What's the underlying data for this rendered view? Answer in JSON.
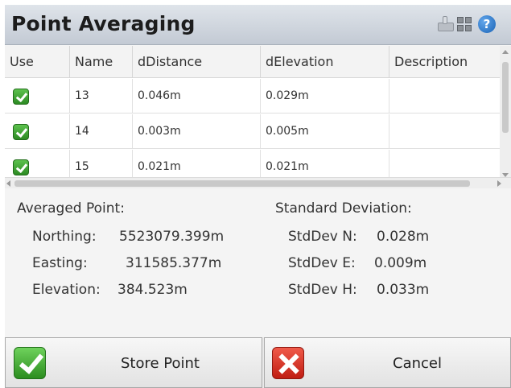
{
  "window": {
    "title": "Point Averaging",
    "icons": [
      "keyboard-icon",
      "grid-icon",
      "help-icon"
    ],
    "help_glyph": "?"
  },
  "table": {
    "columns": [
      "Use",
      "Name",
      "dDistance",
      "dElevation",
      "Description"
    ],
    "rows": [
      {
        "use": true,
        "name": "13",
        "ddistance": "0.046m",
        "delevation": "0.029m",
        "description": ""
      },
      {
        "use": true,
        "name": "14",
        "ddistance": "0.003m",
        "delevation": "0.005m",
        "description": ""
      },
      {
        "use": true,
        "name": "15",
        "ddistance": "0.021m",
        "delevation": "0.021m",
        "description": ""
      }
    ]
  },
  "averaged": {
    "heading": "Averaged Point:",
    "northing_label": "Northing:",
    "northing": "5523079.399m",
    "easting_label": "Easting:",
    "easting": "311585.377m",
    "elevation_label": "Elevation:",
    "elevation": "384.523m"
  },
  "stddev": {
    "heading": "Standard Deviation:",
    "n_label": "StdDev N:",
    "n": "0.028m",
    "e_label": "StdDev E:",
    "e": "0.009m",
    "h_label": "StdDev H:",
    "h": "0.033m"
  },
  "buttons": {
    "store": "Store Point",
    "cancel": "Cancel"
  },
  "colors": {
    "accept": "#3aa52e",
    "reject": "#d8291c",
    "title_bar": "#cfd5dd"
  }
}
